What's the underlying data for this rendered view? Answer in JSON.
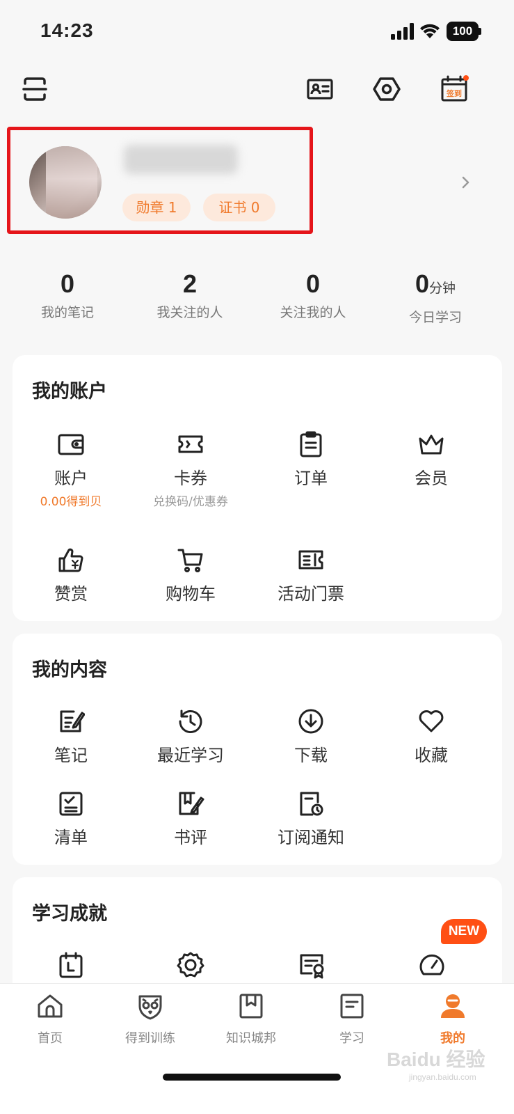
{
  "status": {
    "time": "14:23",
    "battery": "100"
  },
  "header": {
    "checkin_label": "签到"
  },
  "profile": {
    "medal_label": "勋章 1",
    "certificate_label": "证书 0"
  },
  "stats": [
    {
      "value": "0",
      "unit": "",
      "label": "我的笔记"
    },
    {
      "value": "2",
      "unit": "",
      "label": "我关注的人"
    },
    {
      "value": "0",
      "unit": "",
      "label": "关注我的人"
    },
    {
      "value": "0",
      "unit": "分钟",
      "label": "今日学习"
    }
  ],
  "account": {
    "title": "我的账户",
    "items": [
      {
        "label": "账户",
        "sub": "0.00得到贝",
        "icon": "wallet-icon"
      },
      {
        "label": "卡券",
        "sub": "兑换码/优惠券",
        "icon": "ticket-icon"
      },
      {
        "label": "订单",
        "sub": "",
        "icon": "clipboard-icon"
      },
      {
        "label": "会员",
        "sub": "",
        "icon": "crown-icon"
      },
      {
        "label": "赞赏",
        "sub": "",
        "icon": "thumbs-up-yen-icon"
      },
      {
        "label": "购物车",
        "sub": "",
        "icon": "cart-icon"
      },
      {
        "label": "活动门票",
        "sub": "",
        "icon": "event-ticket-icon"
      }
    ]
  },
  "content": {
    "title": "我的内容",
    "items": [
      {
        "label": "笔记",
        "icon": "note-edit-icon"
      },
      {
        "label": "最近学习",
        "icon": "history-icon"
      },
      {
        "label": "下载",
        "icon": "download-icon"
      },
      {
        "label": "收藏",
        "icon": "heart-icon"
      },
      {
        "label": "清单",
        "icon": "checklist-icon"
      },
      {
        "label": "书评",
        "icon": "book-review-icon"
      },
      {
        "label": "订阅通知",
        "icon": "subscription-notice-icon"
      }
    ]
  },
  "achievements": {
    "title": "学习成就",
    "new_badge": "NEW"
  },
  "tabs": [
    {
      "label": "首页",
      "icon": "home-icon",
      "active": false
    },
    {
      "label": "得到训练",
      "icon": "owl-shield-icon",
      "active": false
    },
    {
      "label": "知识城邦",
      "icon": "bookmark-book-icon",
      "active": false
    },
    {
      "label": "学习",
      "icon": "study-doc-icon",
      "active": false
    },
    {
      "label": "我的",
      "icon": "profile-icon",
      "active": true
    }
  ],
  "watermark": {
    "text": "Baidu 经验",
    "sub": "jingyan.baidu.com"
  },
  "colors": {
    "accent": "#f07a2c",
    "highlight_box": "#e5151a",
    "new_badge": "#ff4f14"
  }
}
